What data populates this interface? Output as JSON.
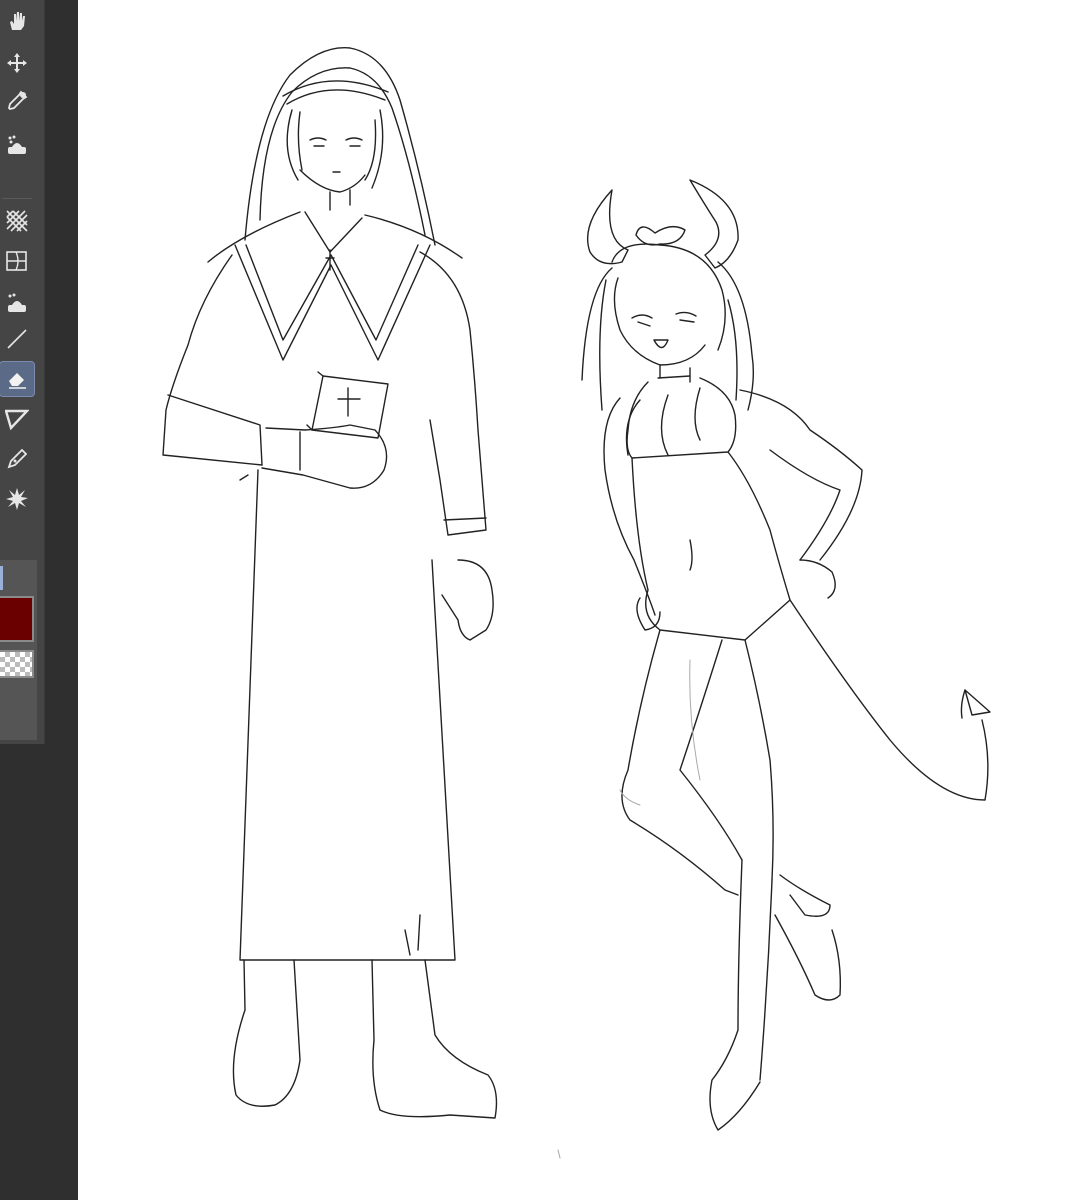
{
  "toolbar": {
    "tools": [
      {
        "id": "hand",
        "icon": "hand-icon"
      },
      {
        "id": "move",
        "icon": "move-arrows-icon"
      },
      {
        "id": "eyedropper",
        "icon": "eyedropper-icon"
      },
      {
        "id": "fill",
        "icon": "fill-bucket-icon"
      },
      {
        "id": "pattern",
        "icon": "pattern-fill-icon"
      },
      {
        "id": "transform",
        "icon": "transform-grid-icon"
      },
      {
        "id": "fill2",
        "icon": "fill-bucket-icon"
      },
      {
        "id": "line",
        "icon": "line-icon"
      },
      {
        "id": "eraser",
        "icon": "eraser-icon",
        "active": true
      },
      {
        "id": "ruler",
        "icon": "ruler-icon"
      },
      {
        "id": "pen",
        "icon": "pen-nib-icon"
      },
      {
        "id": "effect",
        "icon": "burst-icon"
      }
    ]
  },
  "colors": {
    "main": "#6a0000",
    "sub": "transparent",
    "accent": "#5b6a86"
  },
  "canvas": {
    "background": "#ffffff",
    "stroke": "#222222",
    "figures": [
      "nun-figure",
      "devil-girl-figure"
    ]
  }
}
